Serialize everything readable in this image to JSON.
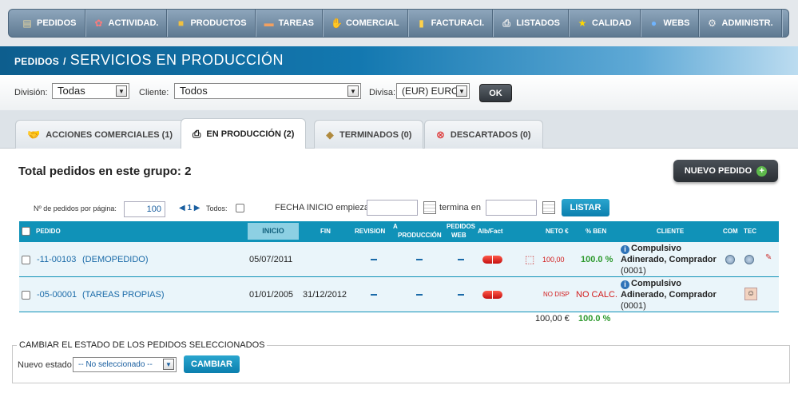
{
  "nav": {
    "items": [
      {
        "label": "PEDIDOS",
        "icon": "clipboard-icon"
      },
      {
        "label": "ACTIVIDAD.",
        "icon": "activity-icon"
      },
      {
        "label": "PRODUCTOS",
        "icon": "box-icon"
      },
      {
        "label": "TAREAS",
        "icon": "tasks-icon"
      },
      {
        "label": "COMERCIAL",
        "icon": "handshake-icon"
      },
      {
        "label": "FACTURACI.",
        "icon": "bar-chart-icon"
      },
      {
        "label": "LISTADOS",
        "icon": "printer-icon"
      },
      {
        "label": "CALIDAD",
        "icon": "star-icon"
      },
      {
        "label": "WEBS",
        "icon": "globe-icon"
      },
      {
        "label": "ADMINISTR.",
        "icon": "gear-icon"
      }
    ]
  },
  "header": {
    "section": "PEDIDOS",
    "separator": "/",
    "title": "SERVICIOS EN PRODUCCIÓN"
  },
  "filters": {
    "division_label": "División:",
    "division_value": "Todas",
    "cliente_label": "Cliente:",
    "cliente_value": "Todos",
    "divisa_label": "Divisa:",
    "divisa_value": "(EUR) EURO",
    "ok_label": "OK"
  },
  "tabs": [
    {
      "label": "ACCIONES COMERCIALES (1)",
      "icon": "handshake-icon",
      "active": false
    },
    {
      "label": "EN PRODUCCIÓN (2)",
      "icon": "printer-icon",
      "active": true
    },
    {
      "label": "TERMINADOS (0)",
      "icon": "tag-icon",
      "active": false
    },
    {
      "label": "DESCARTADOS (0)",
      "icon": "cancel-icon",
      "active": false
    }
  ],
  "group": {
    "total_label": "Total pedidos en este grupo: 2",
    "new_order_label": "NUEVO PEDIDO"
  },
  "controls": {
    "per_page_label": "Nº de pedidos por página:",
    "per_page_value": "100",
    "pager": "◀ 1 ▶",
    "todos_label": "Todos:",
    "fecha_label": "FECHA INICIO empieza",
    "termina_label": "termina en",
    "listar_label": "LISTAR"
  },
  "table": {
    "headers": {
      "pedido": "PEDIDO",
      "inicio": "INICIO",
      "fin": "FIN",
      "revision": "REVISION",
      "a_produccion_1": "A",
      "a_produccion_2": "PRODUCCIÓN",
      "pedidos_web_1": "PEDIDOS",
      "pedidos_web_2": "WEB",
      "alb_fact": "Alb/Fact",
      "neto": "NETO €",
      "ben": "% BEN",
      "cliente": "CLIENTE",
      "com": "COM",
      "tec": "TEC"
    },
    "rows": [
      {
        "pedido": "-11-00103",
        "ref": "(DEMOPEDIDO)",
        "inicio": "05/07/2011",
        "fin": "",
        "neto": "100,00",
        "ben": "100.0 %",
        "cliente_1": "Compulsivo",
        "cliente_2": "Adinerado, Comprador",
        "cliente_3": "(0001)"
      },
      {
        "pedido": "-05-00001",
        "ref": "(TAREAS PROPIAS)",
        "inicio": "01/01/2005",
        "fin": "31/12/2012",
        "neto": "NO DISP",
        "ben": "NO CALC.",
        "cliente_1": "Compulsivo",
        "cliente_2": "Adinerado, Comprador",
        "cliente_3": "(0001)"
      }
    ],
    "totals": {
      "neto": "100,00 €",
      "ben": "100.0 %"
    }
  },
  "state_change": {
    "legend": "CAMBIAR EL ESTADO DE LOS PEDIDOS SELECCIONADOS",
    "label": "Nuevo estado",
    "select_value": "-- No seleccionado --",
    "button_label": "CAMBIAR"
  },
  "colors": {
    "accent": "#1092b8",
    "positive": "#2e9a2e",
    "negative": "#d21a1a"
  }
}
